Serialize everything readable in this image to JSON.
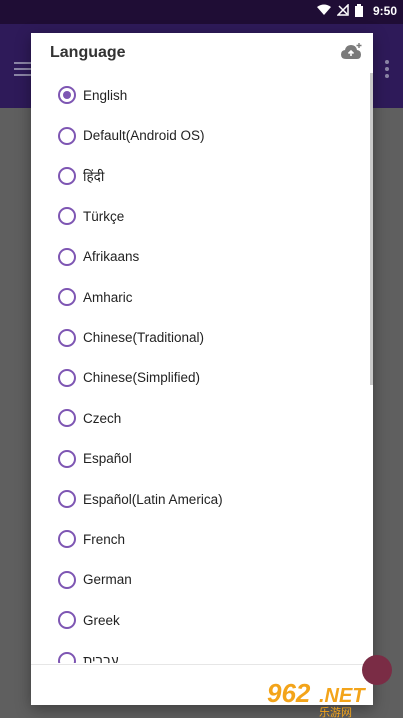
{
  "status_bar": {
    "time": "9:50",
    "icons": [
      "wifi-icon",
      "signal-off-icon",
      "battery-icon"
    ]
  },
  "app_bar": {
    "menu_icon": "menu-icon",
    "overflow_icon": "overflow-icon"
  },
  "dialog": {
    "title": "Language",
    "action_icon": "cloud-upload-icon",
    "selected": "English",
    "languages": [
      "English",
      "Default(Android OS)",
      "हिंदी",
      "Türkçe",
      "Afrikaans",
      "Amharic",
      "Chinese(Traditional)",
      "Chinese(Simplified)",
      "Czech",
      "Español",
      "Español(Latin America)",
      "French",
      "German",
      "Greek",
      "עברית"
    ]
  },
  "watermark": {
    "number": "962",
    "suffix": ".NET",
    "subtitle": "乐游网"
  },
  "colors": {
    "accent": "#7e56b3",
    "app_bar": "#2e1a59",
    "status_bar": "#1f0d35"
  }
}
